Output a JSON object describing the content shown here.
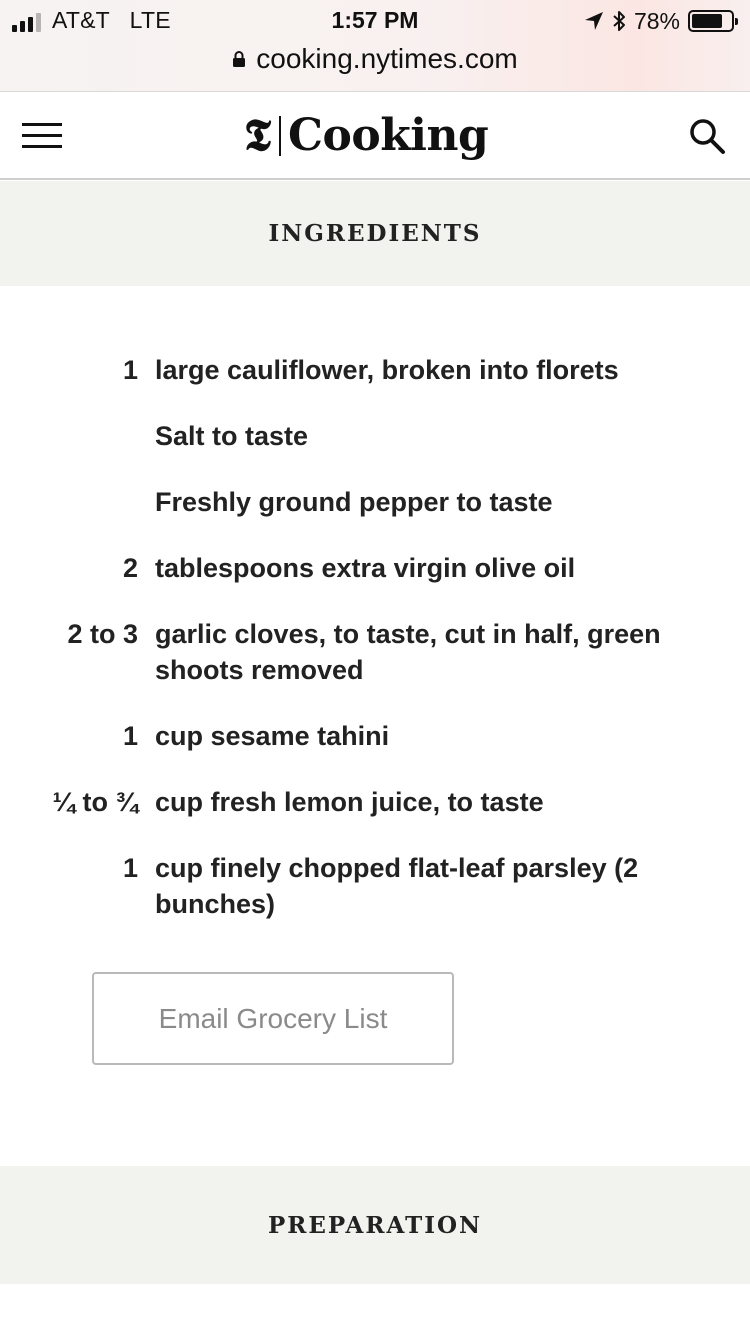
{
  "status_bar": {
    "carrier": "AT&T",
    "network": "LTE",
    "time": "1:57 PM",
    "battery_text": "78%",
    "battery_level": 0.78,
    "signal_bars_active": 3,
    "signal_bars_total": 4,
    "icons": [
      "location-arrow-icon",
      "bluetooth-icon",
      "battery-icon"
    ]
  },
  "browser": {
    "url": "cooking.nytimes.com",
    "lock_icon": "lock-icon"
  },
  "header": {
    "menu_icon": "hamburger-menu-icon",
    "logo_mark": "𝕿",
    "logo_text": "Cooking",
    "search_icon": "search-icon"
  },
  "ingredients": {
    "heading": "INGREDIENTS",
    "items": [
      {
        "qty": "1",
        "text": "large cauliflower, broken into florets"
      },
      {
        "qty": "",
        "text": "Salt to taste"
      },
      {
        "qty": "",
        "text": "Freshly ground pepper to taste"
      },
      {
        "qty": "2",
        "text": "tablespoons extra virgin olive oil"
      },
      {
        "qty": "2 to 3",
        "text": "garlic cloves, to taste, cut in half, green shoots removed"
      },
      {
        "qty": "1",
        "text": "cup sesame tahini"
      },
      {
        "qty": "¼ to ¾",
        "text": "cup fresh lemon juice, to taste"
      },
      {
        "qty": "1",
        "text": "cup finely chopped flat-leaf parsley (2 bunches)"
      }
    ],
    "email_button": "Email Grocery List"
  },
  "preparation": {
    "heading": "PREPARATION"
  }
}
